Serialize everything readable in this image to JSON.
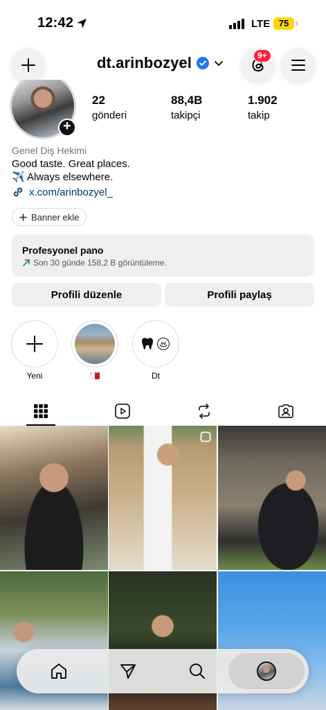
{
  "status_bar": {
    "time": "12:42",
    "network": "LTE",
    "battery": "75"
  },
  "header": {
    "username": "dt.arinbozyel",
    "notification_badge": "9+"
  },
  "stats": [
    {
      "value": "22",
      "label": "gönderi"
    },
    {
      "value": "88,4B",
      "label": "takipçi"
    },
    {
      "value": "1.902",
      "label": "takip"
    }
  ],
  "bio": {
    "category": "Genel Diş Hekimi",
    "line1": "Good taste. Great places.",
    "line2": "✈️ Always elsewhere.",
    "link": "x.com/arinbozyel_"
  },
  "banner_button": "Banner ekle",
  "pro_panel": {
    "title": "Profesyonel pano",
    "subtitle": "Son 30 günde 158,2 B görüntüleme."
  },
  "actions": {
    "edit": "Profili düzenle",
    "share": "Profili paylaş"
  },
  "highlights": [
    {
      "label": "Yeni",
      "icon": "plus-icon"
    },
    {
      "label": "🇲🇹",
      "icon": "malta-flag"
    },
    {
      "label": "Dt",
      "icon": "tooth-icon"
    }
  ],
  "tabs": [
    "grid-icon",
    "reels-icon",
    "reposts-icon",
    "tagged-icon"
  ],
  "bottom_nav": [
    "home-icon",
    "send-icon",
    "search-icon",
    "profile-avatar"
  ],
  "colors": {
    "verified": "#1877f2",
    "badge": "#ff1f3d",
    "battery": "#ffd60a",
    "link": "#00376b"
  }
}
